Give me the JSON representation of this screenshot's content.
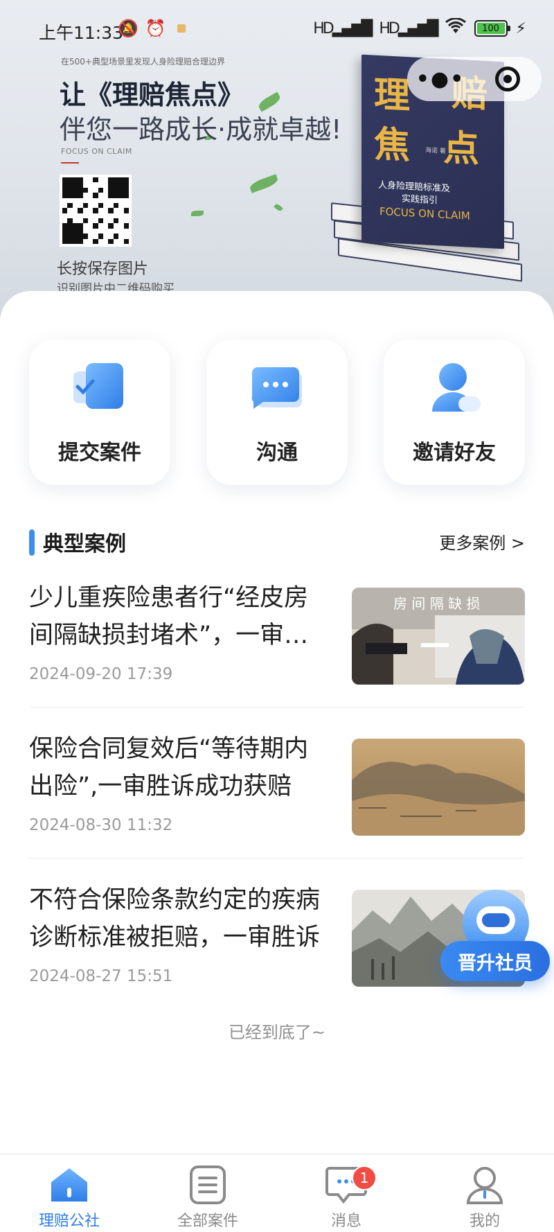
{
  "status_bar": {
    "time": "上午11:33",
    "signal1": "HD",
    "signal2": "HD",
    "battery": "100"
  },
  "banner": {
    "small_text": "在500+典型场景里发现人身险理赔合理边界",
    "title_line1": "让《理赔焦点》",
    "title_line2": "伴您一路成长·成就卓越!",
    "english": "FOCUS ON CLAIM",
    "hint_line1": "长按保存图片",
    "hint_line2": "识别图片中二维码购买",
    "book_title1": "理",
    "book_title2": "赔",
    "book_title3": "焦",
    "book_title4": "点",
    "book_sub1": "人身险理赔标准及",
    "book_sub2": "实践指引",
    "book_en": "FOCUS ON CLAIM",
    "book_author": "海诺 著"
  },
  "capsule": {
    "more_icon": "more-dots-icon",
    "close_icon": "target-close-icon"
  },
  "quick_actions": [
    {
      "label": "提交案件",
      "icon": "submit-case-icon"
    },
    {
      "label": "沟通",
      "icon": "chat-bubble-icon"
    },
    {
      "label": "邀请好友",
      "icon": "invite-friend-icon"
    }
  ],
  "section": {
    "title": "典型案例",
    "more": "更多案例 >"
  },
  "cases": [
    {
      "title": "少儿重疾险患者行“经皮房间隔缺损封堵术”，一审胜诉成功",
      "date": "2024-09-20 17:39",
      "thumb_caption": "房 间 隔 缺 损"
    },
    {
      "title": "保险合同复效后“等待期内出险”,一审胜诉成功获赔",
      "date": "2024-08-30 11:32"
    },
    {
      "title": "不符合保险条款约定的疾病诊断标准被拒赔，一审胜诉",
      "date": "2024-08-27 15:51"
    }
  ],
  "end_text": "已经到底了~",
  "float_button": "晋升社员",
  "tabs": [
    {
      "label": "理赔公社",
      "icon": "home-icon",
      "active": true
    },
    {
      "label": "全部案件",
      "icon": "list-icon",
      "active": false
    },
    {
      "label": "消息",
      "icon": "message-icon",
      "active": false,
      "badge": "1"
    },
    {
      "label": "我的",
      "icon": "profile-icon",
      "active": false
    }
  ],
  "colors": {
    "accent": "#3d8ef0",
    "badge": "#f24b43",
    "book_gold": "#e9b646",
    "book_navy": "#2b2f52"
  }
}
